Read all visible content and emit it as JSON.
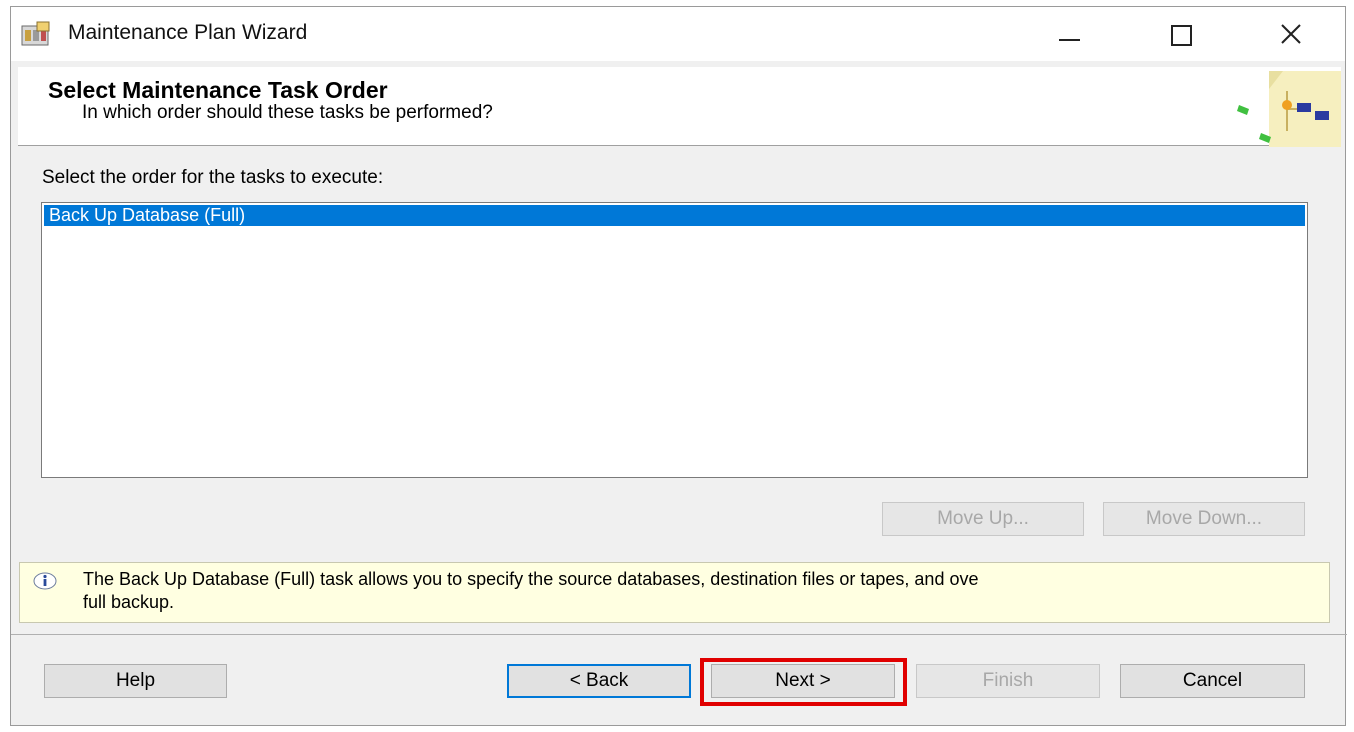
{
  "window": {
    "title": "Maintenance Plan Wizard",
    "app_icon": "maintenance-plan-icon"
  },
  "header": {
    "title": "Select Maintenance Task Order",
    "subtitle": "In which order should these tasks be performed?",
    "graphic": "wizard-graphic"
  },
  "main": {
    "instruction": "Select the order for the tasks to execute:",
    "tasks": [
      {
        "label": "Back Up Database (Full)",
        "selected": true
      }
    ],
    "move_up_label": "Move Up...",
    "move_down_label": "Move Down..."
  },
  "info": {
    "icon": "info-icon",
    "text": "The Back Up Database (Full) task allows you to specify the source databases, destination files or tapes, and ove\nfull backup."
  },
  "footer": {
    "help_label": "Help",
    "back_label": "< Back",
    "next_label": "Next >",
    "finish_label": "Finish",
    "cancel_label": "Cancel"
  },
  "colors": {
    "selection": "#0078d7",
    "info_background": "#ffffe1",
    "highlight": "#e00000"
  }
}
